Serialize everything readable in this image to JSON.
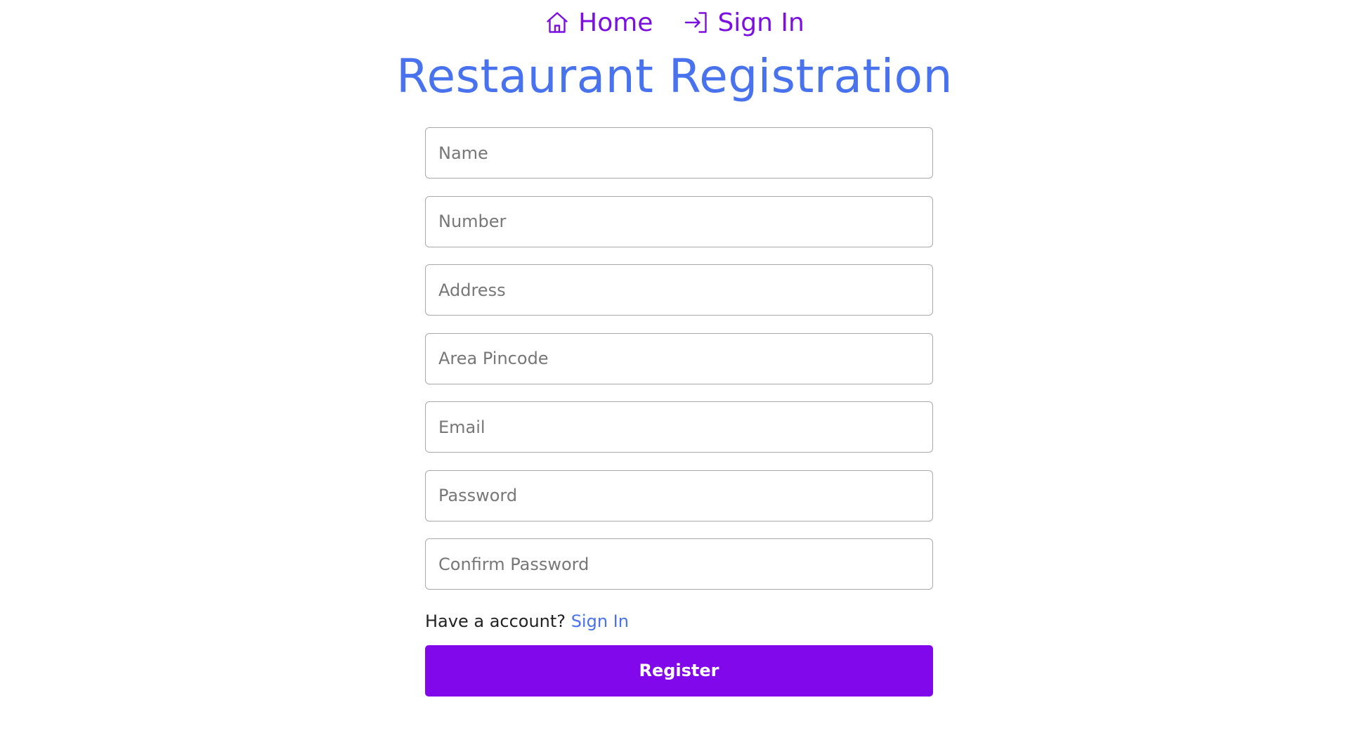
{
  "nav": {
    "home_label": "Home",
    "signin_label": "Sign In",
    "home_icon": "home-icon",
    "signin_icon": "sign-in-icon"
  },
  "title": "Restaurant Registration",
  "form": {
    "name_placeholder": "Name",
    "number_placeholder": "Number",
    "address_placeholder": "Address",
    "pincode_placeholder": "Area Pincode",
    "email_placeholder": "Email",
    "password_placeholder": "Password",
    "confirm_password_placeholder": "Confirm Password",
    "have_account_text": "Have a account?",
    "signin_link": "Sign In",
    "register_label": "Register"
  },
  "colors": {
    "nav": "#7b10e0",
    "title": "#4872ee",
    "link": "#4872ee",
    "button": "#8108ea"
  }
}
